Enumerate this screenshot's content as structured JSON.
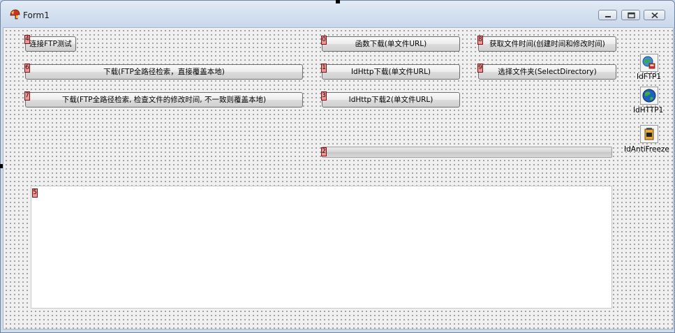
{
  "window": {
    "title": "Form1",
    "controls": {
      "minimize": "minimize-icon",
      "maximize": "maximize-icon",
      "close": "close-icon"
    }
  },
  "buttons": {
    "btn4": {
      "label": "连接FTP测试",
      "tag": "4"
    },
    "btn6": {
      "label": "下载(FTP全路径检索，直接覆盖本地)",
      "tag": "6"
    },
    "btn7": {
      "label": "下载(FTP全路径检索, 检查文件的修改时间, 不一致则覆盖本地)",
      "tag": "7"
    },
    "btn0": {
      "label": "函数下载(单文件URL)",
      "tag": "0"
    },
    "btn1": {
      "label": "IdHttp下载(单文件URL)",
      "tag": "1"
    },
    "btn3": {
      "label": "IdHttp下载2(单文件URL)",
      "tag": "3"
    },
    "btn8": {
      "label": "获取文件时间(创建时间和修改时间)",
      "tag": "8"
    },
    "btn9": {
      "label": "选择文件夹(SelectDirectory)",
      "tag": "9"
    }
  },
  "progress": {
    "tag": "2",
    "value": 0
  },
  "memo": {
    "tag": "5",
    "value": ""
  },
  "components": [
    {
      "label": "IdFTP1",
      "icon": "ftp-component-icon"
    },
    {
      "label": "IdHTTP1",
      "icon": "globe-component-icon"
    },
    {
      "label": "IdAntiFreeze",
      "icon": "antifreeze-component-icon"
    }
  ],
  "colors": {
    "form_background": "#f0f0f0",
    "tag_fill": "#e89a9a",
    "tag_border": "#7a1010",
    "titlebar": "#d6e2f0"
  }
}
